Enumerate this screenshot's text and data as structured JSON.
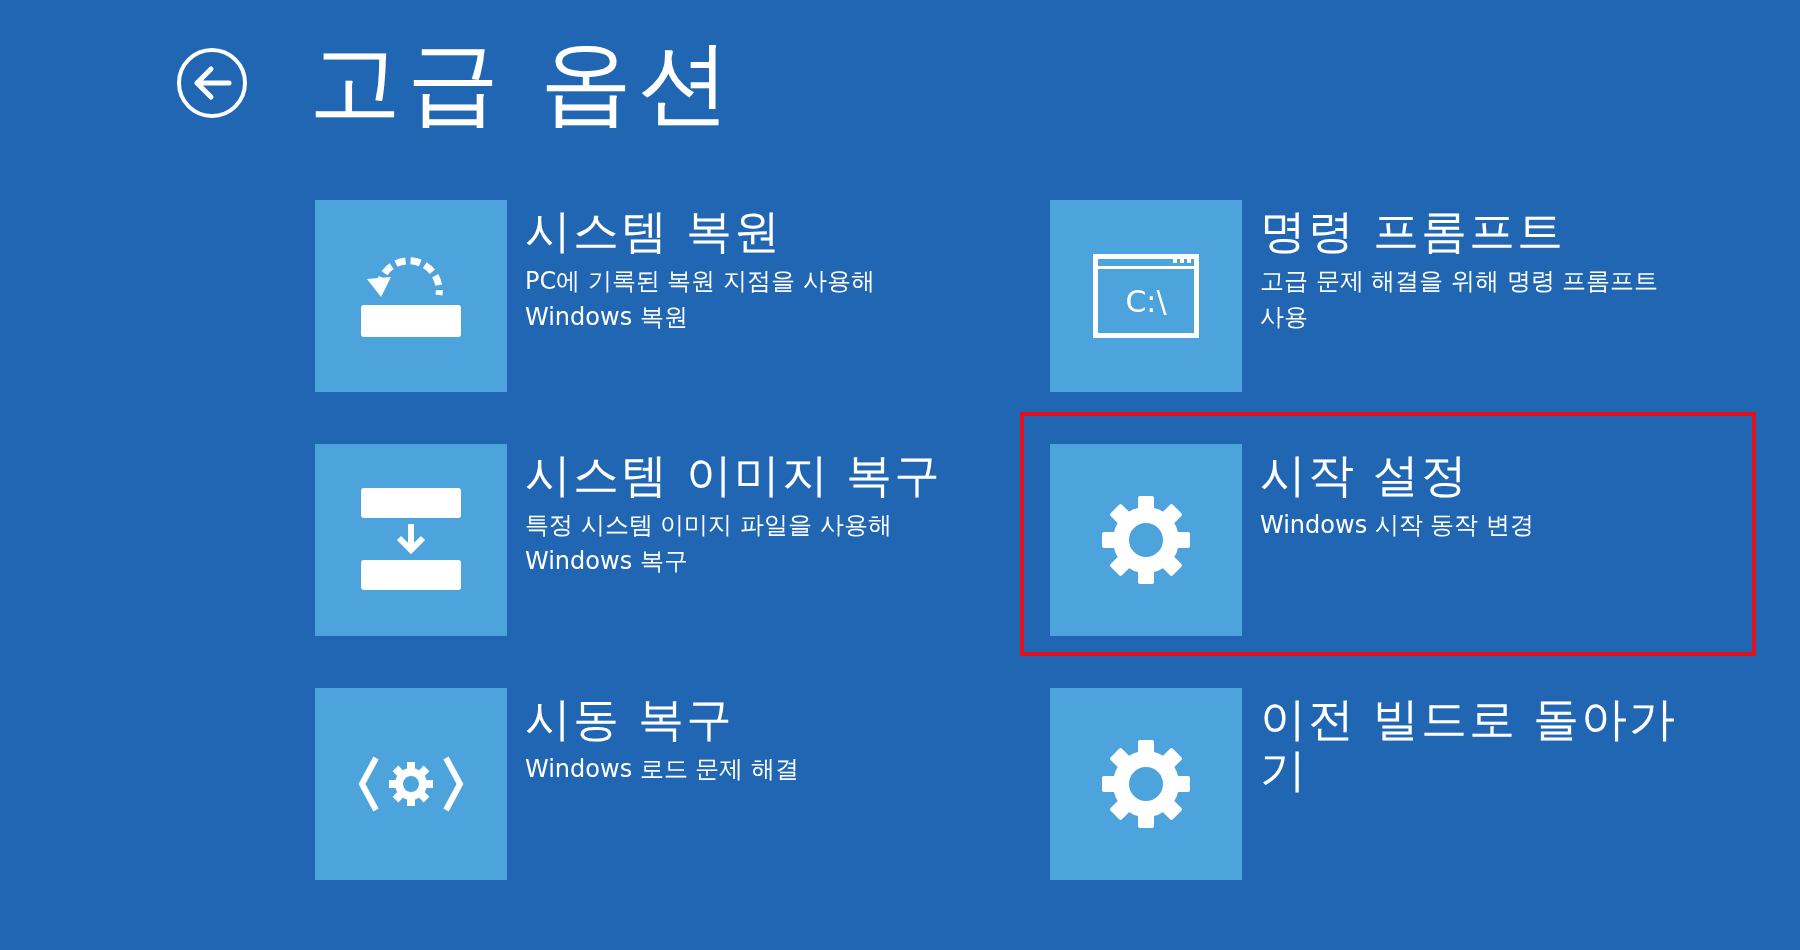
{
  "title": "고급 옵션",
  "options": [
    {
      "kind": "restore",
      "title": "시스템 복원",
      "description": "PC에 기록된 복원 지점을 사용해 Windows 복원",
      "highlighted": false
    },
    {
      "kind": "command",
      "title": "명령 프롬프트",
      "description": "고급 문제 해결을 위해 명령 프롬프트 사용",
      "icon_text": "C:\\",
      "highlighted": false
    },
    {
      "kind": "image",
      "title": "시스템 이미지 복구",
      "description": "특정 시스템 이미지 파일을 사용해 Windows 복구",
      "highlighted": false
    },
    {
      "kind": "gear",
      "title": "시작 설정",
      "description": "Windows 시작 동작 변경",
      "highlighted": true
    },
    {
      "kind": "repair",
      "title": "시동 복구",
      "description": "Windows 로드 문제 해결",
      "highlighted": false
    },
    {
      "kind": "gear",
      "title": "이전 빌드로 돌아가기",
      "highlighted": false
    }
  ]
}
